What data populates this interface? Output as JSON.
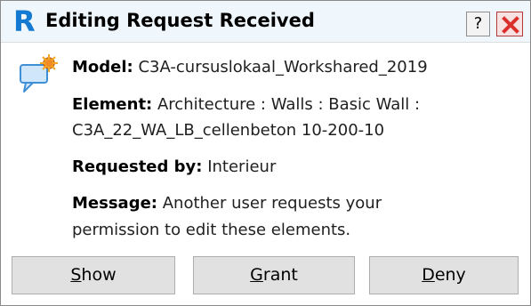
{
  "window": {
    "logo": "R",
    "title": "Editing Request Received",
    "help_label": "?"
  },
  "details": {
    "model_label": "Model:",
    "model_value": " C3A-cursuslokaal_Workshared_2019",
    "element_label": "Element:",
    "element_value_line1": " Architecture : Walls : Basic Wall :",
    "element_value_line2": "C3A_22_WA_LB_cellenbeton 10-200-10",
    "requested_label": "Requested by:",
    "requested_value": " Interieur",
    "message_label": "Message:",
    "message_value_line1": " Another user requests your",
    "message_value_line2": "permission to edit these elements."
  },
  "buttons": {
    "show_key": "S",
    "show_rest": "how",
    "grant_key": "G",
    "grant_rest": "rant",
    "deny_key": "D",
    "deny_rest": "eny"
  },
  "icons": {
    "app": "revit-logo-icon",
    "help": "help-icon",
    "close": "close-icon",
    "message": "speech-bubble-alert-icon"
  },
  "colors": {
    "accent": "#1479d1",
    "close": "#d9302c",
    "bubble": "#3f8fd6",
    "alert": "#f5a623"
  }
}
